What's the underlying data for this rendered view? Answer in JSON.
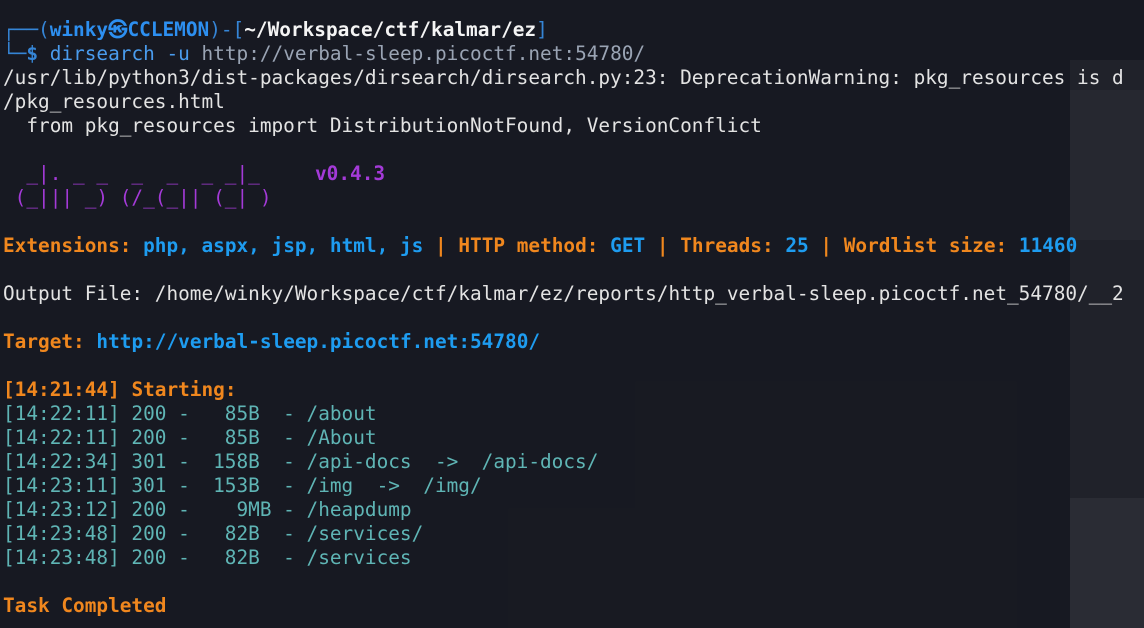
{
  "prompt": {
    "user": "winky",
    "host": "CCLEMON",
    "cwd": "~/Workspace/ctf/kalmar/ez",
    "command": "dirsearch -u",
    "command_url": "http://verbal-sleep.picoctf.net:54780/"
  },
  "warning": {
    "line1": "/usr/lib/python3/dist-packages/dirsearch/dirsearch.py:23: DeprecationWarning: pkg_resources is d",
    "line2": "/pkg_resources.html",
    "line3": "  from pkg_resources import DistributionNotFound, VersionConflict"
  },
  "banner": {
    "art1": "  _|. _ _  _  _  _ _|_",
    "art2": " (_||| _) (/_(_|| (_| )",
    "version": "v0.4.3"
  },
  "config": {
    "extensions_label": "Extensions:",
    "extensions": "php, aspx, jsp, html, js",
    "method_label": "HTTP method:",
    "method": "GET",
    "threads_label": "Threads:",
    "threads": "25",
    "wordlist_label": "Wordlist size:",
    "wordlist": "11460",
    "separator": "|"
  },
  "output": {
    "label": "Output File:",
    "path": "/home/winky/Workspace/ctf/kalmar/ez/reports/http_verbal-sleep.picoctf.net_54780/__2"
  },
  "target": {
    "label": "Target:",
    "url": "http://verbal-sleep.picoctf.net:54780/"
  },
  "start": {
    "time": "[14:21:44]",
    "label": "Starting:"
  },
  "results": [
    {
      "line": "[14:22:11] 200 -   85B  - /about"
    },
    {
      "line": "[14:22:11] 200 -   85B  - /About"
    },
    {
      "line": "[14:22:34] 301 -  158B  - /api-docs  ->  /api-docs/"
    },
    {
      "line": "[14:23:11] 301 -  153B  - /img  ->  /img/"
    },
    {
      "line": "[14:23:12] 200 -    9MB - /heapdump"
    },
    {
      "line": "[14:23:48] 200 -   82B  - /services/"
    },
    {
      "line": "[14:23:48] 200 -   82B  - /services"
    }
  ],
  "footer": {
    "completed": "Task Completed"
  }
}
